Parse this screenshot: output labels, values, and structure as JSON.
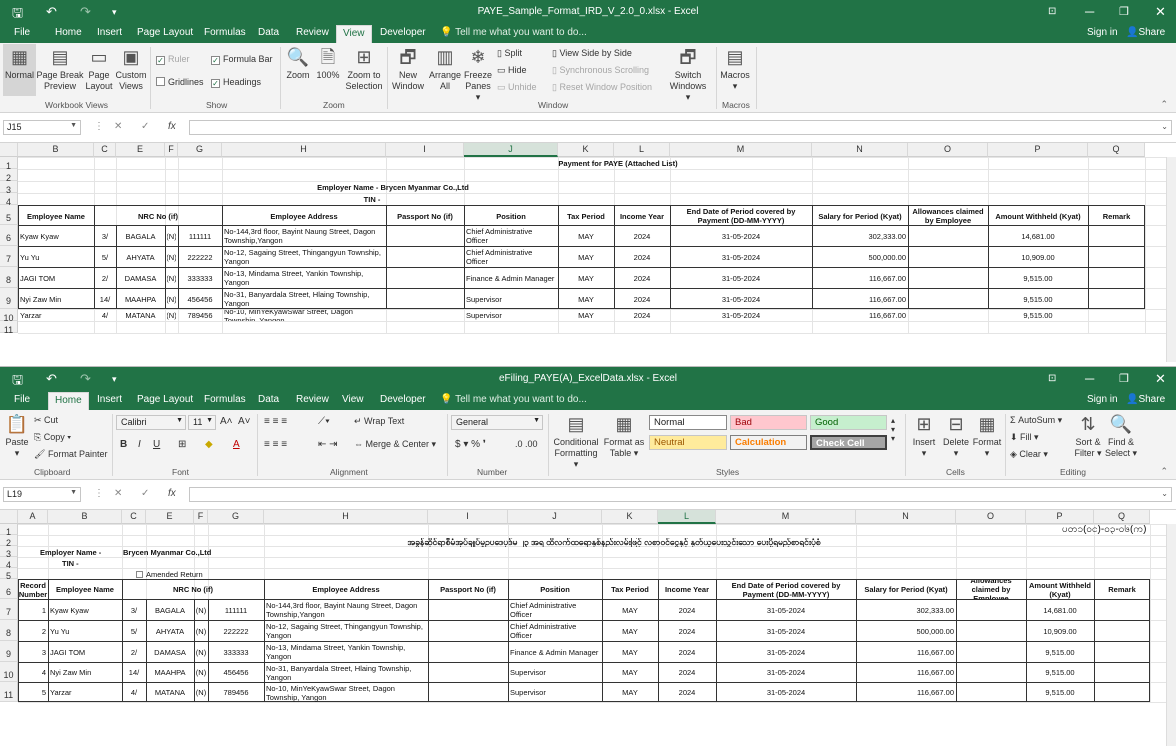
{
  "top": {
    "title": "PAYE_Sample_Format_IRD_V_2.0_0.xlsx - Excel",
    "tabs": [
      "File",
      "Home",
      "Insert",
      "Page Layout",
      "Formulas",
      "Data",
      "Review",
      "View",
      "Developer"
    ],
    "tell_me": "Tell me what you want to do...",
    "sign_in": "Sign in",
    "share": "Share",
    "ribbon": {
      "workbook_views": [
        "Normal",
        "Page Break\nPreview",
        "Page\nLayout",
        "Custom\nViews"
      ],
      "show": {
        "ruler": "Ruler",
        "formula_bar": "Formula Bar",
        "gridlines": "Gridlines",
        "headings": "Headings"
      },
      "zoom": [
        "Zoom",
        "100%",
        "Zoom to\nSelection"
      ],
      "window_big": [
        "New\nWindow",
        "Arrange\nAll",
        "Freeze\nPanes ▾"
      ],
      "window_small": {
        "split": "Split",
        "hide": "Hide",
        "unhide": "Unhide",
        "side": "View Side by Side",
        "sync": "Synchronous Scrolling",
        "reset": "Reset Window Position"
      },
      "switch": "Switch\nWindows ▾",
      "macros": "Macros\n▾",
      "groups": {
        "wv": "Workbook Views",
        "show": "Show",
        "zoom": "Zoom",
        "window": "Window",
        "macros": "Macros"
      }
    },
    "namebox": "J15",
    "columns": [
      "B",
      "C",
      "E",
      "F",
      "G",
      "H",
      "I",
      "J",
      "K",
      "L",
      "M",
      "N",
      "O",
      "P",
      "Q"
    ],
    "rows": [
      "1",
      "2",
      "3",
      "4",
      "5",
      "6",
      "7",
      "8",
      "9",
      "10",
      "11"
    ],
    "title_text": "Payment for PAYE (Attached List)",
    "employer_name": "Employer Name -  Brycen Myanmar Co.,Ltd",
    "tin": "TIN -",
    "headers": [
      "Employee Name",
      "NRC No (if)",
      "Employee Address",
      "Passport No (if)",
      "Position",
      "Tax Period",
      "Income Year",
      "End Date of Period covered by Payment (DD-MM-YYYY)",
      "Salary for Period (Kyat)",
      "Allowances claimed by Employee",
      "Amount Withheld (Kyat)",
      "Remark"
    ]
  },
  "bottom": {
    "title": "eFiling_PAYE(A)_ExcelData.xlsx - Excel",
    "tabs": [
      "File",
      "Home",
      "Insert",
      "Page Layout",
      "Formulas",
      "Data",
      "Review",
      "View",
      "Developer"
    ],
    "tell_me": "Tell me what you want to do...",
    "sign_in": "Sign in",
    "share": "Share",
    "ribbon": {
      "paste": "Paste\n▾",
      "cut": "Cut",
      "copy": "Copy ▾",
      "format_painter": "Format Painter",
      "font_name": "Calibri",
      "font_size": "11",
      "wrap": "Wrap Text",
      "merge": "Merge & Center ▾",
      "number_format": "General",
      "cond": "Conditional\nFormatting ▾",
      "fmt_table": "Format as\nTable ▾",
      "styles": {
        "normal": "Normal",
        "bad": "Bad",
        "good": "Good",
        "neutral": "Neutral",
        "calculation": "Calculation",
        "check": "Check Cell"
      },
      "insert": "Insert\n▾",
      "delete": "Delete\n▾",
      "format": "Format\n▾",
      "autosum": "AutoSum ▾",
      "fill": "Fill ▾",
      "clear": "Clear ▾",
      "sort": "Sort &\nFilter ▾",
      "find": "Find &\nSelect ▾",
      "groups": {
        "clipboard": "Clipboard",
        "font": "Font",
        "alignment": "Alignment",
        "number": "Number",
        "styles": "Styles",
        "cells": "Cells",
        "editing": "Editing"
      }
    },
    "namebox": "L19",
    "columns": [
      "A",
      "B",
      "C",
      "E",
      "F",
      "G",
      "H",
      "I",
      "J",
      "K",
      "L",
      "M",
      "N",
      "O",
      "P",
      "Q"
    ],
    "rows": [
      "1",
      "2",
      "3",
      "4",
      "5",
      "6",
      "7",
      "8",
      "9",
      "10",
      "11"
    ],
    "form_code": "ပတ၁(ဝင)-ဝ၃-ဝ၆(က)",
    "myanmar_title": "အခွန်ဆိုင်ရာစီမံအုပ်ချုပ်မှုဥပဒေပုဒ်မ ၂၃ အရ ထိလက်ထရောနှစ်နည်းလမ်းဖြင့် လစာဝင်ငွေနှင့် နုတ်ယူပေးသွင်းသော ပေးပို့ရမည့်စာရင်းပုံစံ",
    "employer_label": "Employer Name -",
    "employer_value": "Brycen Myanmar Co.,Ltd",
    "tin": "TIN -",
    "amended": "Amended Return",
    "headers": [
      "Record Number",
      "Employee Name",
      "NRC No (if)",
      "Employee Address",
      "Passport No (if)",
      "Position",
      "Tax Period",
      "Income Year",
      "End Date of Period covered by Payment (DD-MM-YYYY)",
      "Salary for Period (Kyat)",
      "Allowances claimed by Employee",
      "Amount Withheld (Kyat)",
      "Remark"
    ]
  },
  "records": [
    {
      "no": "1",
      "name": "Kyaw Kyaw",
      "nrc1": "3/",
      "nrc2": "BAGALA",
      "nrc3": "(N)",
      "nrc4": "111111",
      "address": "No-144,3rd floor, Bayint Naung Street, Dagon Township,Yangon",
      "position": "Chief Administrative Officer",
      "tax_period": "MAY",
      "year": "2024",
      "end_date": "31-05-2024",
      "salary": "302,333.00",
      "withheld": "14,681.00"
    },
    {
      "no": "2",
      "name": "Yu Yu",
      "nrc1": "5/",
      "nrc2": "AHYATA",
      "nrc3": "(N)",
      "nrc4": "222222",
      "address": "No-12, Sagaing Street, Thingangyun Township, Yangon",
      "position": "Chief Administrative Officer",
      "tax_period": "MAY",
      "year": "2024",
      "end_date": "31-05-2024",
      "salary": "500,000.00",
      "withheld": "10,909.00"
    },
    {
      "no": "3",
      "name": "JAGI TOM",
      "nrc1": "2/",
      "nrc2": "DAMASA",
      "nrc3": "(N)",
      "nrc4": "333333",
      "address": "No-13, Mindama Street, Yankin Township, Yangon",
      "position": "Finance & Admin Manager",
      "tax_period": "MAY",
      "year": "2024",
      "end_date": "31-05-2024",
      "salary": "116,667.00",
      "withheld": "9,515.00"
    },
    {
      "no": "4",
      "name": "Nyi Zaw Min",
      "nrc1": "14/",
      "nrc2": "MAAHPA",
      "nrc3": "(N)",
      "nrc4": "456456",
      "address": "No-31, Banyardala Street, Hlaing Township, Yangon",
      "position": "Supervisor",
      "tax_period": "MAY",
      "year": "2024",
      "end_date": "31-05-2024",
      "salary": "116,667.00",
      "withheld": "9,515.00"
    },
    {
      "no": "5",
      "name": "Yarzar",
      "nrc1": "4/",
      "nrc2": "MATANA",
      "nrc3": "(N)",
      "nrc4": "789456",
      "address": "No-10, MinYeKyawSwar Street, Dagon Township, Yangon",
      "position": "Supervisor",
      "tax_period": "MAY",
      "year": "2024",
      "end_date": "31-05-2024",
      "salary": "116,667.00",
      "withheld": "9,515.00"
    }
  ]
}
